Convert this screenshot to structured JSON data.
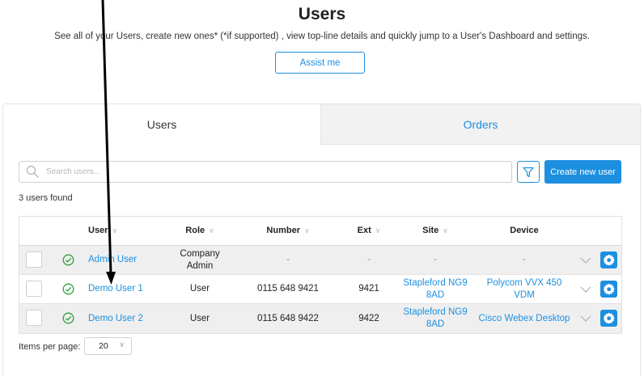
{
  "header": {
    "title": "Users",
    "subtitle": "See all of your Users, create new ones* (*if supported) , view top-line details and quickly jump to a User's Dashboard and settings.",
    "assist_label": "Assist me"
  },
  "tabs": [
    {
      "label": "Users",
      "active": true
    },
    {
      "label": "Orders",
      "active": false
    }
  ],
  "search": {
    "placeholder": "Search users..."
  },
  "toolbar": {
    "create_label": "Create new user"
  },
  "count_text": "3 users found",
  "table": {
    "columns": [
      "User",
      "Role",
      "Number",
      "Ext",
      "Site",
      "Device"
    ],
    "rows": [
      {
        "user": "Admin User",
        "role": "Company Admin",
        "number": "-",
        "ext": "-",
        "site": "-",
        "device": "-"
      },
      {
        "user": "Demo User 1",
        "role": "User",
        "number": "0115 648 9421",
        "ext": "9421",
        "site": "Stapleford NG9 8AD",
        "device": "Polycom VVX 450 VDM"
      },
      {
        "user": "Demo User 2",
        "role": "User",
        "number": "0115 648 9422",
        "ext": "9422",
        "site": "Stapleford NG9 8AD",
        "device": "Cisco Webex Desktop"
      }
    ]
  },
  "pagination": {
    "label": "Items per page:",
    "value": "20"
  },
  "colors": {
    "accent": "#1d8fe0",
    "success": "#2e9e3a",
    "row_grey": "#efefef"
  },
  "icons": {
    "search": "search-icon",
    "filter": "filter-icon",
    "status": "check-circle-icon",
    "expand": "chevron-down-icon",
    "settings": "gear-icon",
    "annotation": "arrow-annotation"
  }
}
